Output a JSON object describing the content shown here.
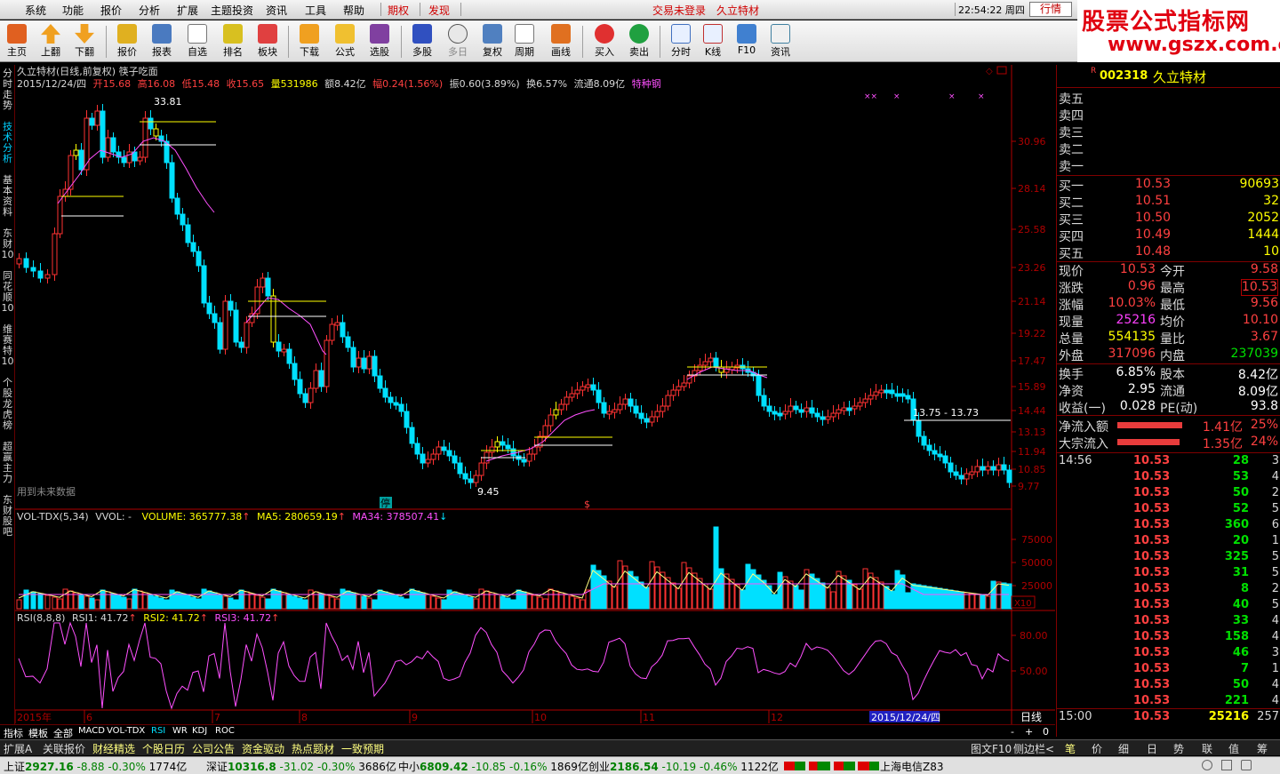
{
  "menu": {
    "items": [
      "系统",
      "功能",
      "报价",
      "分析",
      "扩展",
      "主题投资",
      "资讯",
      "工具",
      "帮助"
    ],
    "special": [
      "期权",
      "发现"
    ],
    "login": "交易未登录",
    "stock": "久立特材",
    "clock": "22:54:22 周四",
    "quote_label": "行情"
  },
  "watermark": {
    "title": "股票公式指标网",
    "url": "www.gszx.com.cn"
  },
  "toolbar": [
    "主页",
    "上翻",
    "下翻",
    "报价",
    "报表",
    "自选",
    "排名",
    "板块",
    "下载",
    "公式",
    "选股",
    "多股",
    "多日",
    "复权",
    "周期",
    "画线",
    "买入",
    "卖出",
    "分时",
    "K线",
    "F10",
    "资讯"
  ],
  "sidetabs": [
    "分时走势",
    "技术分析",
    "基本资料",
    "东财10",
    "同花顺10",
    "维赛特10",
    "个股龙虎榜",
    "超赢主力",
    "东财股吧"
  ],
  "chart_header": {
    "title": "久立特材(日线,前复权) 筷子吃面",
    "date": "2015/12/24/四",
    "open_label": "开",
    "open": "15.68",
    "high_label": "高",
    "high": "16.08",
    "low_label": "低",
    "low": "15.48",
    "close_label": "收",
    "close": "15.65",
    "vol_label": "量",
    "vol": "531986",
    "amt_label": "额",
    "amt": "8.42亿",
    "chg_label": "幅",
    "chg": "0.24(1.56%)",
    "amp_label": "振",
    "amp": "0.60(3.89%)",
    "turn_label": "换",
    "turn": "6.57%",
    "float_label": "流通",
    "float": "8.09亿",
    "sector": "特种钢"
  },
  "annotations": {
    "peak": "33.81",
    "trough": "9.45",
    "range": "13.75 - 13.73",
    "future": "用到未来数据",
    "halt": "停",
    "s_mark": "$"
  },
  "chart_data": [
    {
      "type": "candlestick",
      "price_ticks": [
        "30.96",
        "28.14",
        "25.58",
        "23.26",
        "21.14",
        "19.22",
        "17.47",
        "15.89",
        "14.44",
        "13.13",
        "11.94",
        "10.85",
        "9.77"
      ],
      "months": [
        "2015年",
        "6",
        "7",
        "8",
        "9",
        "10",
        "11",
        "12"
      ],
      "highlight_date": "2015/12/24/四",
      "period": "日线"
    },
    {
      "type": "bar",
      "indicator": "VOL-TDX(5,34)",
      "vvol": "VVOL: -",
      "volume_label": "VOLUME: 365777.38",
      "ma5_label": "MA5: 280659.19",
      "ma34_label": "MA34: 378507.41",
      "ticks": [
        "75000",
        "50000",
        "25000"
      ],
      "unit": "X10"
    },
    {
      "type": "line",
      "indicator": "RSI(8,8,8)",
      "rsi1": "RSI1: 41.72",
      "rsi2": "RSI2: 41.72",
      "rsi3": "RSI3: 41.72",
      "ticks": [
        "80.00",
        "50.00"
      ]
    }
  ],
  "bottom_tabs": [
    "指标",
    "模板",
    "全部",
    "MACD",
    "VOL-TDX",
    "RSI",
    "WR",
    "KDJ",
    "ROC"
  ],
  "bottom_ctrl": {
    "minus": "-",
    "plus": "+",
    "zero": "0"
  },
  "func_tabs": [
    "扩展A",
    "关联报价",
    "财经精选",
    "个股日历",
    "公司公告",
    "资金驱动",
    "热点题材",
    "一致预期"
  ],
  "func_right": [
    "图文F10",
    "侧边栏<"
  ],
  "right_tabs": [
    "笔",
    "价",
    "细",
    "日",
    "势",
    "联",
    "值",
    "筹"
  ],
  "stock_panel": {
    "marker": "R",
    "code": "002318",
    "name": "久立特材",
    "asks": [
      {
        "k": "卖五"
      },
      {
        "k": "卖四"
      },
      {
        "k": "卖三"
      },
      {
        "k": "卖二"
      },
      {
        "k": "卖一"
      }
    ],
    "bids": [
      {
        "k": "买一",
        "p": "10.53",
        "v": "90693"
      },
      {
        "k": "买二",
        "p": "10.51",
        "v": "32"
      },
      {
        "k": "买三",
        "p": "10.50",
        "v": "2052"
      },
      {
        "k": "买四",
        "p": "10.49",
        "v": "1444"
      },
      {
        "k": "买五",
        "p": "10.48",
        "v": "10"
      }
    ],
    "stats": [
      {
        "k1": "现价",
        "v1": "10.53",
        "k2": "今开",
        "v2": "9.58"
      },
      {
        "k1": "涨跌",
        "v1": "0.96",
        "k2": "最高",
        "v2": "10.53"
      },
      {
        "k1": "涨幅",
        "v1": "10.03%",
        "k2": "最低",
        "v2": "9.56"
      },
      {
        "k1": "现量",
        "v1": "25216",
        "k2": "均价",
        "v2": "10.10"
      },
      {
        "k1": "总量",
        "v1": "554135",
        "k2": "量比",
        "v2": "3.67"
      },
      {
        "k1": "外盘",
        "v1": "317096",
        "k2": "内盘",
        "v2": "237039"
      },
      {
        "k1": "换手",
        "v1": "6.85%",
        "k2": "股本",
        "v2": "8.42亿"
      },
      {
        "k1": "净资",
        "v1": "2.95",
        "k2": "流通",
        "v2": "8.09亿"
      },
      {
        "k1": "收益(一)",
        "v1": "0.028",
        "k2": "PE(动)",
        "v2": "93.8"
      }
    ],
    "flows": [
      {
        "k": "净流入额",
        "v": "1.41亿",
        "pct": "25%",
        "level": 0.25
      },
      {
        "k": "大宗流入",
        "v": "1.35亿",
        "pct": "24%",
        "level": 0.24
      }
    ],
    "ticks": [
      {
        "t": "14:56",
        "p": "10.53",
        "v": "28",
        "n": "3"
      },
      {
        "t": "",
        "p": "10.53",
        "v": "53",
        "n": "4"
      },
      {
        "t": "",
        "p": "10.53",
        "v": "50",
        "n": "2"
      },
      {
        "t": "",
        "p": "10.53",
        "v": "52",
        "n": "5"
      },
      {
        "t": "",
        "p": "10.53",
        "v": "360",
        "n": "6"
      },
      {
        "t": "",
        "p": "10.53",
        "v": "20",
        "n": "1"
      },
      {
        "t": "",
        "p": "10.53",
        "v": "325",
        "n": "5"
      },
      {
        "t": "",
        "p": "10.53",
        "v": "31",
        "n": "5"
      },
      {
        "t": "",
        "p": "10.53",
        "v": "8",
        "n": "2"
      },
      {
        "t": "",
        "p": "10.53",
        "v": "40",
        "n": "5"
      },
      {
        "t": "",
        "p": "10.53",
        "v": "33",
        "n": "4"
      },
      {
        "t": "",
        "p": "10.53",
        "v": "158",
        "n": "4"
      },
      {
        "t": "",
        "p": "10.53",
        "v": "46",
        "n": "3"
      },
      {
        "t": "",
        "p": "10.53",
        "v": "7",
        "n": "1"
      },
      {
        "t": "",
        "p": "10.53",
        "v": "50",
        "n": "4"
      },
      {
        "t": "",
        "p": "10.53",
        "v": "221",
        "n": "4"
      },
      {
        "t": "15:00",
        "p": "10.53",
        "v": "25216",
        "n": "257"
      }
    ]
  },
  "status": {
    "sh_label": "上证",
    "sh": "2927.16",
    "sh_chg": "-8.88",
    "sh_pct": "-0.30%",
    "sh_amt": "1774亿",
    "sz_label": "深证",
    "sz": "10316.8",
    "sz_chg": "-31.02",
    "sz_pct": "-0.30%",
    "sz_amt": "3686亿",
    "zx_label": "中小",
    "zx": "6809.42",
    "zx_chg": "-10.85",
    "zx_pct": "-0.16%",
    "zx_amt": "1869亿",
    "cy_label": "创业",
    "cy": "2186.54",
    "cy_chg": "-10.19",
    "cy_pct": "-0.46%",
    "cy_amt": "1122亿",
    "server": "上海电信Z83"
  },
  "colors": {
    "up": "#ff3232",
    "down": "#00e0ff",
    "ma": "#ff50ff",
    "ma5": "#ffff80",
    "signal": "#ffff00",
    "axis": "#b00000"
  }
}
